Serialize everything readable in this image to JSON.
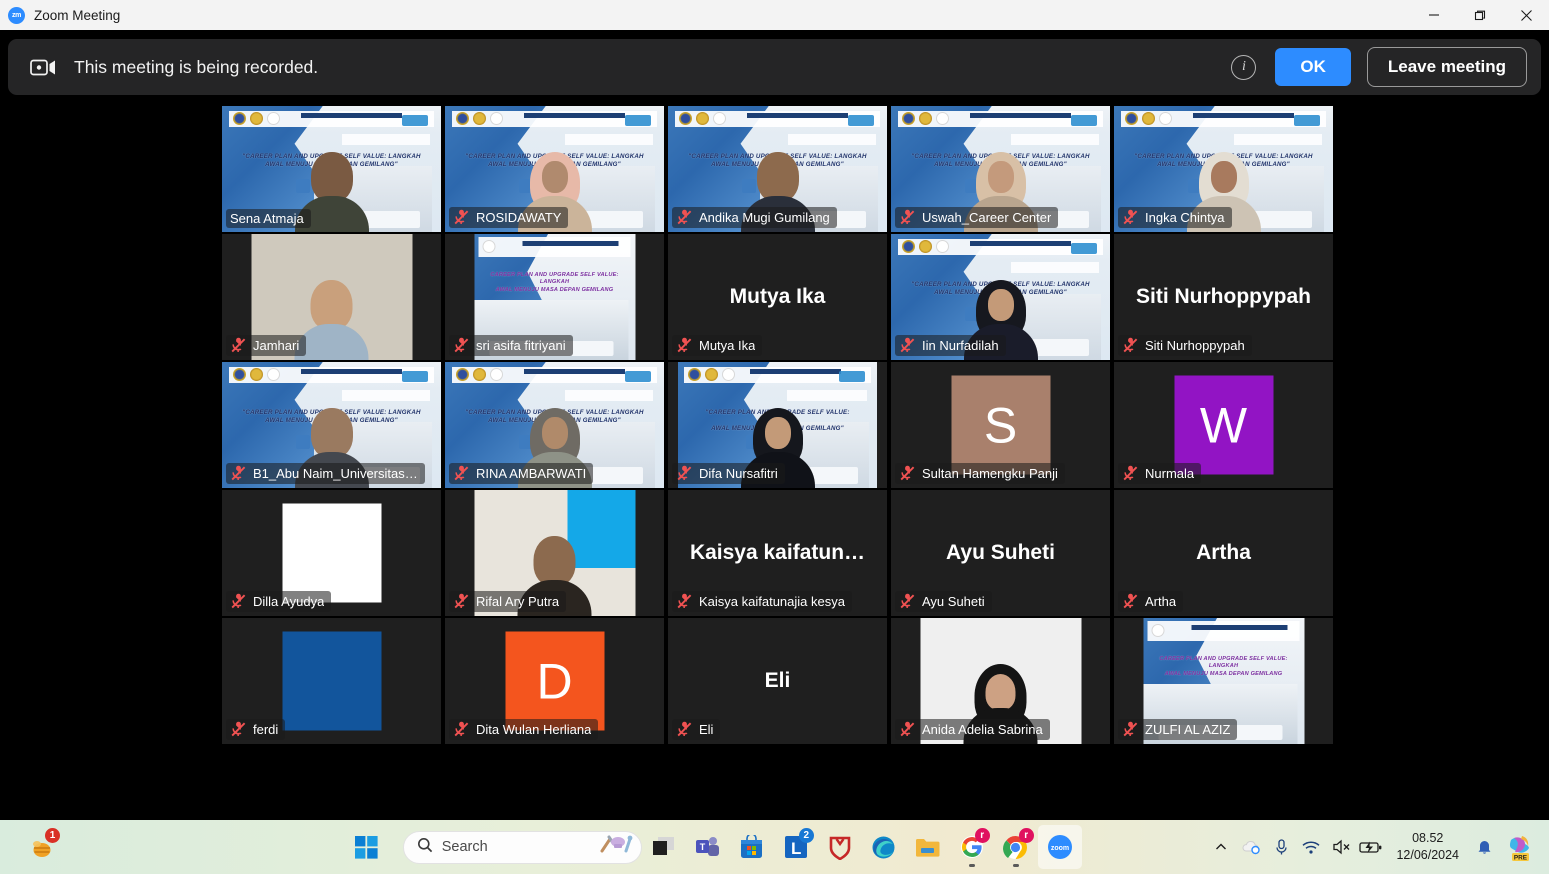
{
  "window": {
    "title": "Zoom Meeting",
    "app_icon": "zoom-logo-icon",
    "minimize_label": "Minimize",
    "restore_label": "Restore",
    "close_label": "Close"
  },
  "banner": {
    "icon": "record-camera-icon",
    "message": "This meeting is being recorded.",
    "info_icon": "info-icon",
    "info_glyph": "i",
    "ok_label": "OK",
    "leave_label": "Leave meeting",
    "ok_color": "#2d8cff"
  },
  "gallery": {
    "active_speaker_border_color": "#d3ee56",
    "participants": [
      {
        "name": "Sena Atmaja",
        "muted": false,
        "active": true,
        "view": "seminar",
        "skin": "#7a5a42",
        "shirt": "#3f4438",
        "hijab": false
      },
      {
        "name": "ROSIDAWATY",
        "muted": true,
        "active": false,
        "view": "seminar",
        "skin": "#b08a6e",
        "shirt": "#cbb49a",
        "hijab": true,
        "hijab_color": "#e7b9a8"
      },
      {
        "name": "Andika Mugi Gumilang",
        "muted": true,
        "active": false,
        "view": "seminar",
        "skin": "#8d6a4d",
        "shirt": "#2a2f3a",
        "hijab": false
      },
      {
        "name": "Uswah_Career Center",
        "muted": true,
        "active": false,
        "view": "seminar",
        "skin": "#c49a7c",
        "shirt": "#b9a58e",
        "hijab": true,
        "hijab_color": "#d8c0a6"
      },
      {
        "name": "Ingka Chintya",
        "muted": true,
        "active": false,
        "view": "seminar",
        "skin": "#a87a5e",
        "shirt": "#cdc3b4",
        "hijab": true,
        "hijab_color": "#e3ddd2"
      },
      {
        "name": "Jamhari",
        "muted": true,
        "active": false,
        "view": "video-small",
        "bg": "#cfc9bd",
        "skin": "#c9a07c",
        "shirt": "#9fb4c6",
        "hijab": false
      },
      {
        "name": "sri asifa fitriyani",
        "muted": true,
        "active": false,
        "view": "seminar-small"
      },
      {
        "name": "Mutya Ika",
        "muted": true,
        "active": false,
        "view": "name",
        "display_name": "Mutya Ika"
      },
      {
        "name": "Iin Nurfadilah",
        "muted": true,
        "active": false,
        "view": "seminar",
        "skin": "#c49a78",
        "shirt": "#1a1c2a",
        "hijab": true,
        "hijab_color": "#16181f"
      },
      {
        "name": "Siti Nurhoppypah",
        "muted": true,
        "active": false,
        "view": "name",
        "display_name": "Siti Nurhoppypah"
      },
      {
        "name": "B1_Abu Naim_Universitas…",
        "muted": true,
        "active": false,
        "view": "seminar",
        "skin": "#9a7a60",
        "shirt": "#44484f",
        "hijab": false
      },
      {
        "name": "RINA AMBARWATI",
        "muted": true,
        "active": false,
        "view": "seminar",
        "skin": "#b08a6a",
        "shirt": "#8e9287",
        "hijab": true,
        "hijab_color": "#6f6b64"
      },
      {
        "name": "Difa Nursafitri",
        "muted": true,
        "active": false,
        "view": "seminar-wide",
        "skin": "#c39a78",
        "shirt": "#101218",
        "hijab": true,
        "hijab_color": "#15171d"
      },
      {
        "name": "Sultan Hamengku Panji",
        "muted": true,
        "active": false,
        "view": "avatar",
        "initial": "S",
        "avatar_color": "#a9806c"
      },
      {
        "name": "Nurmala",
        "muted": true,
        "active": false,
        "view": "avatar",
        "initial": "W",
        "avatar_color": "#9214c4"
      },
      {
        "name": "Dilla Ayudya",
        "muted": true,
        "active": false,
        "view": "block",
        "block_color": "#ffffff"
      },
      {
        "name": "Rifal Ary Putra",
        "muted": true,
        "active": false,
        "view": "video-small",
        "bg": "#e8e4dc",
        "skin": "#8c6a4e",
        "shirt": "#2a2520",
        "hijab": false,
        "sky": "#14a8e8"
      },
      {
        "name": "Kaisya kaifatunajia kesya",
        "muted": true,
        "active": false,
        "view": "name",
        "display_name": "Kaisya  kaifatun…"
      },
      {
        "name": "Ayu Suheti",
        "muted": true,
        "active": false,
        "view": "name",
        "display_name": "Ayu Suheti"
      },
      {
        "name": "Artha",
        "muted": true,
        "active": false,
        "view": "name",
        "display_name": "Artha"
      },
      {
        "name": "ferdi",
        "muted": true,
        "active": false,
        "view": "block",
        "block_color": "#12559c"
      },
      {
        "name": "Dita Wulan Herliana",
        "muted": true,
        "active": false,
        "view": "avatar",
        "initial": "D",
        "avatar_color": "#f4551e"
      },
      {
        "name": "Eli",
        "muted": true,
        "active": false,
        "view": "name",
        "display_name": "Eli"
      },
      {
        "name": "Anida Adelia Sabrina",
        "muted": true,
        "active": false,
        "view": "video-small",
        "bg": "#efefef",
        "skin": "#cda183",
        "shirt": "#141414",
        "hijab": true,
        "hijab_color": "#141414"
      },
      {
        "name": "ZULFI AL AZIZ",
        "muted": true,
        "active": false,
        "view": "seminar-small"
      }
    ]
  },
  "taskbar": {
    "notification_badge": "1",
    "notification_icon": "bee-notification-icon",
    "start_icon": "windows-start-icon",
    "search": {
      "icon": "search-icon",
      "placeholder": "Search",
      "widget_icon": "cooking-widget-icon"
    },
    "apps": [
      {
        "name": "task-view",
        "icon": "task-view-icon",
        "badge": "",
        "running": false
      },
      {
        "name": "microsoft-teams",
        "icon": "teams-icon",
        "badge": "",
        "running": false
      },
      {
        "name": "microsoft-store",
        "icon": "microsoft-store-icon",
        "badge": "",
        "running": false
      },
      {
        "name": "linkedin",
        "icon": "linkedin-icon",
        "badge": "2",
        "running": false
      },
      {
        "name": "security-shield",
        "icon": "shield-icon",
        "badge": "",
        "running": false
      },
      {
        "name": "microsoft-edge",
        "icon": "edge-icon",
        "badge": "",
        "running": false
      },
      {
        "name": "file-explorer",
        "icon": "folder-icon",
        "badge": "",
        "running": false
      },
      {
        "name": "google",
        "icon": "google-icon",
        "badge": "r",
        "running": true
      },
      {
        "name": "google-chrome",
        "icon": "chrome-icon",
        "badge": "r",
        "running": true
      },
      {
        "name": "zoom",
        "icon": "zoom-app-icon",
        "badge": "",
        "running": true,
        "active": true
      }
    ],
    "tray": [
      {
        "name": "show-hidden-icons",
        "icon": "chevron-up-icon"
      },
      {
        "name": "onedrive",
        "icon": "cloud-sync-icon"
      },
      {
        "name": "microphone",
        "icon": "microphone-icon"
      },
      {
        "name": "network",
        "icon": "wifi-icon"
      },
      {
        "name": "volume",
        "icon": "speaker-mute-icon"
      },
      {
        "name": "battery",
        "icon": "battery-charging-icon"
      }
    ],
    "clock": {
      "time": "08.52",
      "date": "12/06/2024"
    },
    "notifications_icon": "bell-icon",
    "copilot_icon": "copilot-pre-icon",
    "copilot_badge": "PRE"
  }
}
